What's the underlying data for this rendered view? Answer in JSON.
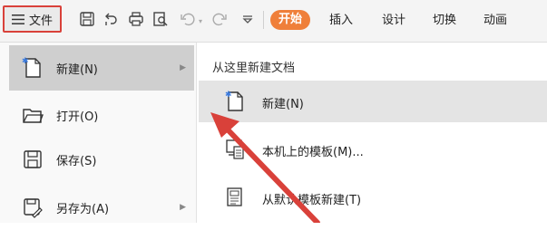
{
  "toolbar": {
    "file_label": "文件",
    "tabs": [
      {
        "label": "开始",
        "active": true
      },
      {
        "label": "插入",
        "active": false
      },
      {
        "label": "设计",
        "active": false
      },
      {
        "label": "切换",
        "active": false
      },
      {
        "label": "动画",
        "active": false
      }
    ],
    "icons": [
      "save-icon",
      "export-icon",
      "print-icon",
      "print-preview-icon",
      "undo-icon",
      "redo-icon",
      "more-dropdown-icon"
    ]
  },
  "left_menu": {
    "items": [
      {
        "label": "新建(N)",
        "icon": "new-file-icon",
        "has_submenu": true,
        "highlighted": true
      },
      {
        "label": "打开(O)",
        "icon": "open-folder-icon",
        "has_submenu": false,
        "highlighted": false
      },
      {
        "label": "保存(S)",
        "icon": "save-icon",
        "has_submenu": false,
        "highlighted": false
      },
      {
        "label": "另存为(A)",
        "icon": "save-as-icon",
        "has_submenu": true,
        "highlighted": false
      }
    ]
  },
  "submenu": {
    "header": "从这里新建文档",
    "items": [
      {
        "label": "新建(N)",
        "icon": "new-file-icon",
        "highlighted": true
      },
      {
        "label": "本机上的模板(M)...",
        "icon": "local-template-icon",
        "highlighted": false
      },
      {
        "label": "从默认模板新建(T)",
        "icon": "default-template-icon",
        "highlighted": false
      }
    ]
  },
  "colors": {
    "accent": "#ef7f3a",
    "annotation": "#d9413a",
    "highlight": "#cfcfcf"
  }
}
